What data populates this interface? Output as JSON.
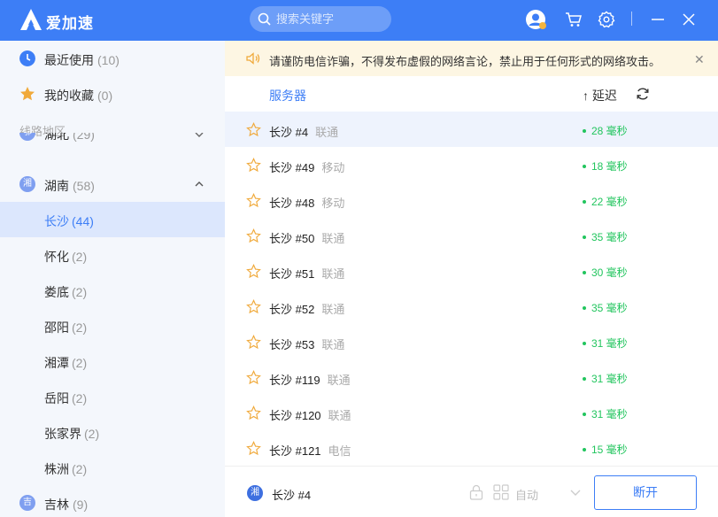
{
  "app": {
    "name": "爱加速"
  },
  "search": {
    "placeholder": "搜索关键字"
  },
  "sidebar": {
    "recent": {
      "label": "最近使用",
      "count": "(10)"
    },
    "favorites": {
      "label": "我的收藏",
      "count": "(0)"
    },
    "section_title": "线路地区",
    "prev_province": {
      "badge": "鄂",
      "label": "湖北",
      "count": "(29)"
    },
    "province": {
      "badge": "湘",
      "label": "湖南",
      "count": "(58)"
    },
    "cities": [
      {
        "label": "长沙",
        "count": "(44)",
        "active": true
      },
      {
        "label": "怀化",
        "count": "(2)"
      },
      {
        "label": "娄底",
        "count": "(2)"
      },
      {
        "label": "邵阳",
        "count": "(2)"
      },
      {
        "label": "湘潭",
        "count": "(2)"
      },
      {
        "label": "岳阳",
        "count": "(2)"
      },
      {
        "label": "张家界",
        "count": "(2)"
      },
      {
        "label": "株洲",
        "count": "(2)"
      }
    ],
    "next_province": {
      "badge": "吉",
      "label": "吉林",
      "count": "(9)"
    }
  },
  "notice": {
    "text": "请谨防电信诈骗，不得发布虚假的网络言论，禁止用于任何形式的网络攻击。"
  },
  "list_header": {
    "server": "服务器",
    "sort": "↑ 延迟"
  },
  "servers": [
    {
      "name": "长沙 #4",
      "isp": "联通",
      "latency": "28 毫秒"
    },
    {
      "name": "长沙 #49",
      "isp": "移动",
      "latency": "18 毫秒"
    },
    {
      "name": "长沙 #48",
      "isp": "移动",
      "latency": "22 毫秒"
    },
    {
      "name": "长沙 #50",
      "isp": "联通",
      "latency": "35 毫秒"
    },
    {
      "name": "长沙 #51",
      "isp": "联通",
      "latency": "30 毫秒"
    },
    {
      "name": "长沙 #52",
      "isp": "联通",
      "latency": "35 毫秒"
    },
    {
      "name": "长沙 #53",
      "isp": "联通",
      "latency": "31 毫秒"
    },
    {
      "name": "长沙 #119",
      "isp": "联通",
      "latency": "31 毫秒"
    },
    {
      "name": "长沙 #120",
      "isp": "联通",
      "latency": "31 毫秒"
    },
    {
      "name": "长沙 #121",
      "isp": "电信",
      "latency": "15 毫秒"
    }
  ],
  "footer": {
    "badge": "湘",
    "current": "长沙 #4",
    "mode": "自动",
    "disconnect": "断开"
  },
  "colors": {
    "brand": "#3d7ef6",
    "latency": "#22c55e",
    "star": "#f0a93a",
    "notice_bg": "#fdf6e3"
  },
  "icons": {
    "titlebar": [
      "user-avatar-icon",
      "cart-icon",
      "settings-gear-icon",
      "minimize-icon",
      "close-icon"
    ]
  }
}
